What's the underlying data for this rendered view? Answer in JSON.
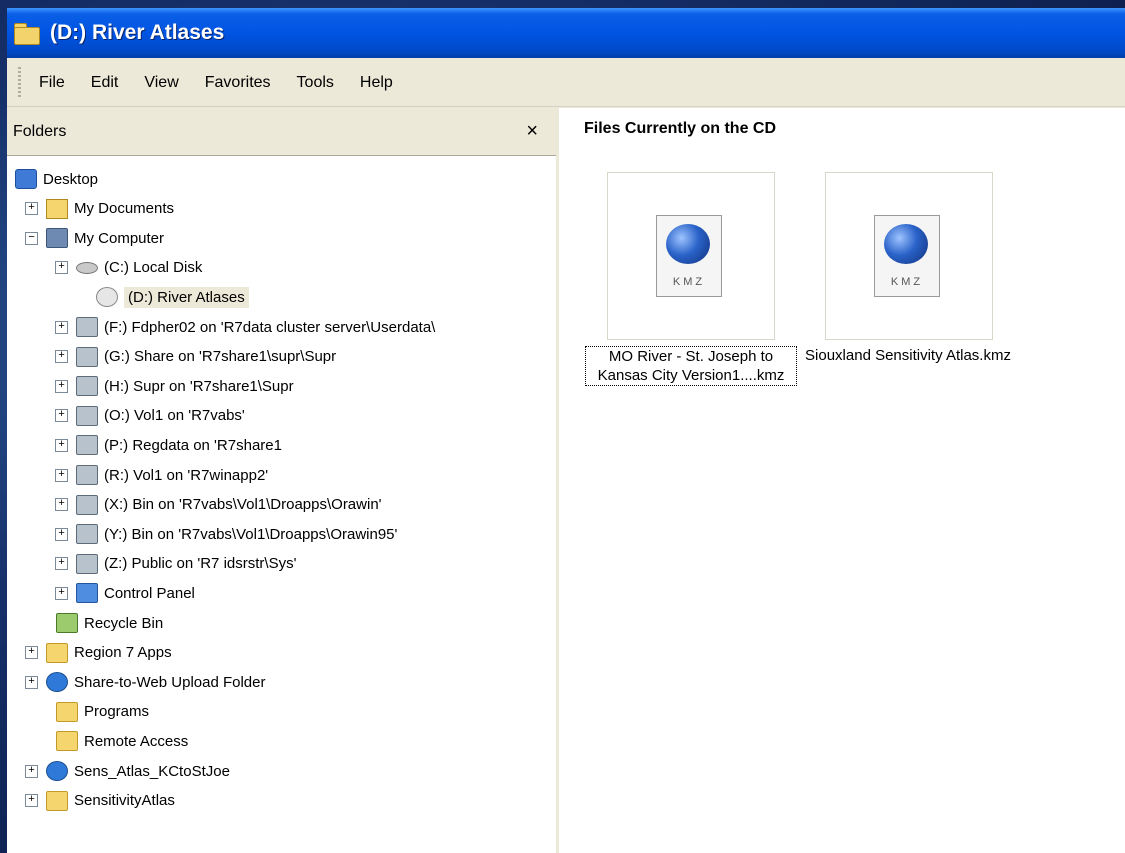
{
  "window": {
    "title": "(D:) River Atlases"
  },
  "menu": [
    "File",
    "Edit",
    "View",
    "Favorites",
    "Tools",
    "Help"
  ],
  "folders_pane": {
    "title": "Folders",
    "close_glyph": "×",
    "tree": [
      {
        "label": "Desktop",
        "expander": "",
        "icon": "desktop-icon"
      },
      {
        "label": "My Documents",
        "expander": "+",
        "icon": "documents-folder-icon"
      },
      {
        "label": "My Computer",
        "expander": "−",
        "icon": "computer-icon"
      },
      {
        "label": "(C:) Local Disk",
        "expander": "+",
        "icon": "local-disk-icon"
      },
      {
        "label": "(D:) River Atlases",
        "expander": "",
        "icon": "cd-drive-icon",
        "selected": true
      },
      {
        "label": "(F:) Fdpher02 on 'R7data cluster server\\Userdata\\",
        "expander": "+",
        "icon": "network-drive-icon"
      },
      {
        "label": "(G:) Share on 'R7share1\\supr\\Supr",
        "expander": "+",
        "icon": "network-drive-icon"
      },
      {
        "label": "(H:) Supr on 'R7share1\\Supr",
        "expander": "+",
        "icon": "network-drive-icon"
      },
      {
        "label": "(O:) Vol1 on 'R7vabs'",
        "expander": "+",
        "icon": "network-drive-icon"
      },
      {
        "label": "(P:) Regdata on 'R7share1",
        "expander": "+",
        "icon": "network-drive-icon"
      },
      {
        "label": "(R:) Vol1 on 'R7winapp2'",
        "expander": "+",
        "icon": "network-drive-icon"
      },
      {
        "label": "(X:) Bin on 'R7vabs\\Vol1\\Droapps\\Orawin'",
        "expander": "+",
        "icon": "network-drive-icon"
      },
      {
        "label": "(Y:) Bin on 'R7vabs\\Vol1\\Droapps\\Orawin95'",
        "expander": "+",
        "icon": "network-drive-icon"
      },
      {
        "label": "(Z:) Public on 'R7 idsrstr\\Sys'",
        "expander": "+",
        "icon": "network-drive-icon"
      },
      {
        "label": "Control Panel",
        "expander": "+",
        "icon": "control-panel-icon"
      },
      {
        "label": "Recycle Bin",
        "expander": "",
        "icon": "recycle-bin-icon"
      },
      {
        "label": "Region 7 Apps",
        "expander": "+",
        "icon": "apps-folder-icon"
      },
      {
        "label": "Share-to-Web Upload Folder",
        "expander": "+",
        "icon": "web-folder-icon"
      },
      {
        "label": "Programs",
        "expander": "",
        "icon": "folder-icon"
      },
      {
        "label": "Remote Access",
        "expander": "",
        "icon": "folder-icon"
      },
      {
        "label": "Sens_Atlas_KCtoStJoe",
        "expander": "+",
        "icon": "globe-icon"
      },
      {
        "label": "SensitivityAtlas",
        "expander": "+",
        "icon": "folder-icon"
      }
    ]
  },
  "files_pane": {
    "title": "Files Currently on the CD",
    "files": [
      {
        "name": "MO River - St. Joseph to Kansas City Version1....kmz",
        "icon_text": "KMZ",
        "focused": true
      },
      {
        "name": "Siouxland Sensitivity Atlas.kmz",
        "icon_text": "KMZ",
        "focused": false
      }
    ]
  }
}
